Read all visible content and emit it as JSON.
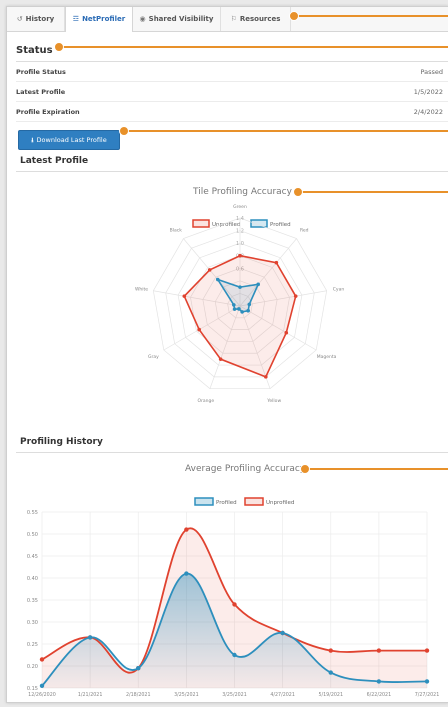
{
  "tabs": [
    {
      "icon": "↺",
      "label": "History"
    },
    {
      "icon": "☲",
      "label": "NetProfiler"
    },
    {
      "icon": "◉",
      "label": "Shared Visibility"
    },
    {
      "icon": "⚐",
      "label": "Resources"
    }
  ],
  "status": {
    "heading": "Status",
    "rows": [
      {
        "label": "Profile Status",
        "value": "Passed"
      },
      {
        "label": "Latest Profile",
        "value": "1/5/2022"
      },
      {
        "label": "Profile Expiration",
        "value": "2/4/2022"
      }
    ]
  },
  "download_button": {
    "icon": "⭳",
    "label": "Download Last Profile"
  },
  "latest_profile_heading": "Latest Profile",
  "profiling_history_heading": "Profiling History",
  "colors": {
    "unprofiled": "#e0422f",
    "profiled": "#2d8fbd",
    "callout": "#e8912a",
    "accent": "#2f7fc1"
  },
  "chart_data": [
    {
      "type": "radar",
      "title": "Tile Profiling Accuracy",
      "legend": [
        "Unprofiled",
        "Profiled"
      ],
      "legend_position": "top",
      "axes": [
        "Green",
        "Red",
        "Cyan",
        "Magenta",
        "Yellow",
        "Orange",
        "Gray",
        "White",
        "Black"
      ],
      "tick_labels": [
        "1.4",
        "1.2",
        "1.0",
        "0.8",
        "0.6"
      ],
      "scale_max": 1.4,
      "series": [
        {
          "name": "Unprofiled",
          "values": [
            0.8,
            0.9,
            0.9,
            0.85,
            1.2,
            0.9,
            0.75,
            0.9,
            0.75
          ]
        },
        {
          "name": "Profiled",
          "values": [
            0.3,
            0.45,
            0.15,
            0.15,
            0.1,
            0.05,
            0.1,
            0.1,
            0.55
          ]
        }
      ]
    },
    {
      "type": "line",
      "title": "Average Profiling Accuracy",
      "legend": [
        "Profiled",
        "Unprofiled"
      ],
      "legend_position": "top",
      "x": [
        "12/26/2020",
        "1/21/2021",
        "2/18/2021",
        "3/25/2021",
        "3/25/2021",
        "4/27/2021",
        "5/19/2021",
        "6/22/2021",
        "7/27/2021"
      ],
      "ylim": [
        0.15,
        0.55
      ],
      "y_ticks": [
        "0.55",
        "0.50",
        "0.45",
        "0.40",
        "0.35",
        "0.30",
        "0.25",
        "0.20",
        "0.15"
      ],
      "series": [
        {
          "name": "Profiled",
          "values": [
            0.155,
            0.265,
            0.195,
            0.41,
            0.225,
            0.275,
            0.185,
            0.165,
            0.165
          ]
        },
        {
          "name": "Unprofiled",
          "values": [
            0.215,
            0.265,
            0.195,
            0.51,
            0.34,
            0.275,
            0.235,
            0.235,
            0.235
          ]
        }
      ]
    }
  ]
}
